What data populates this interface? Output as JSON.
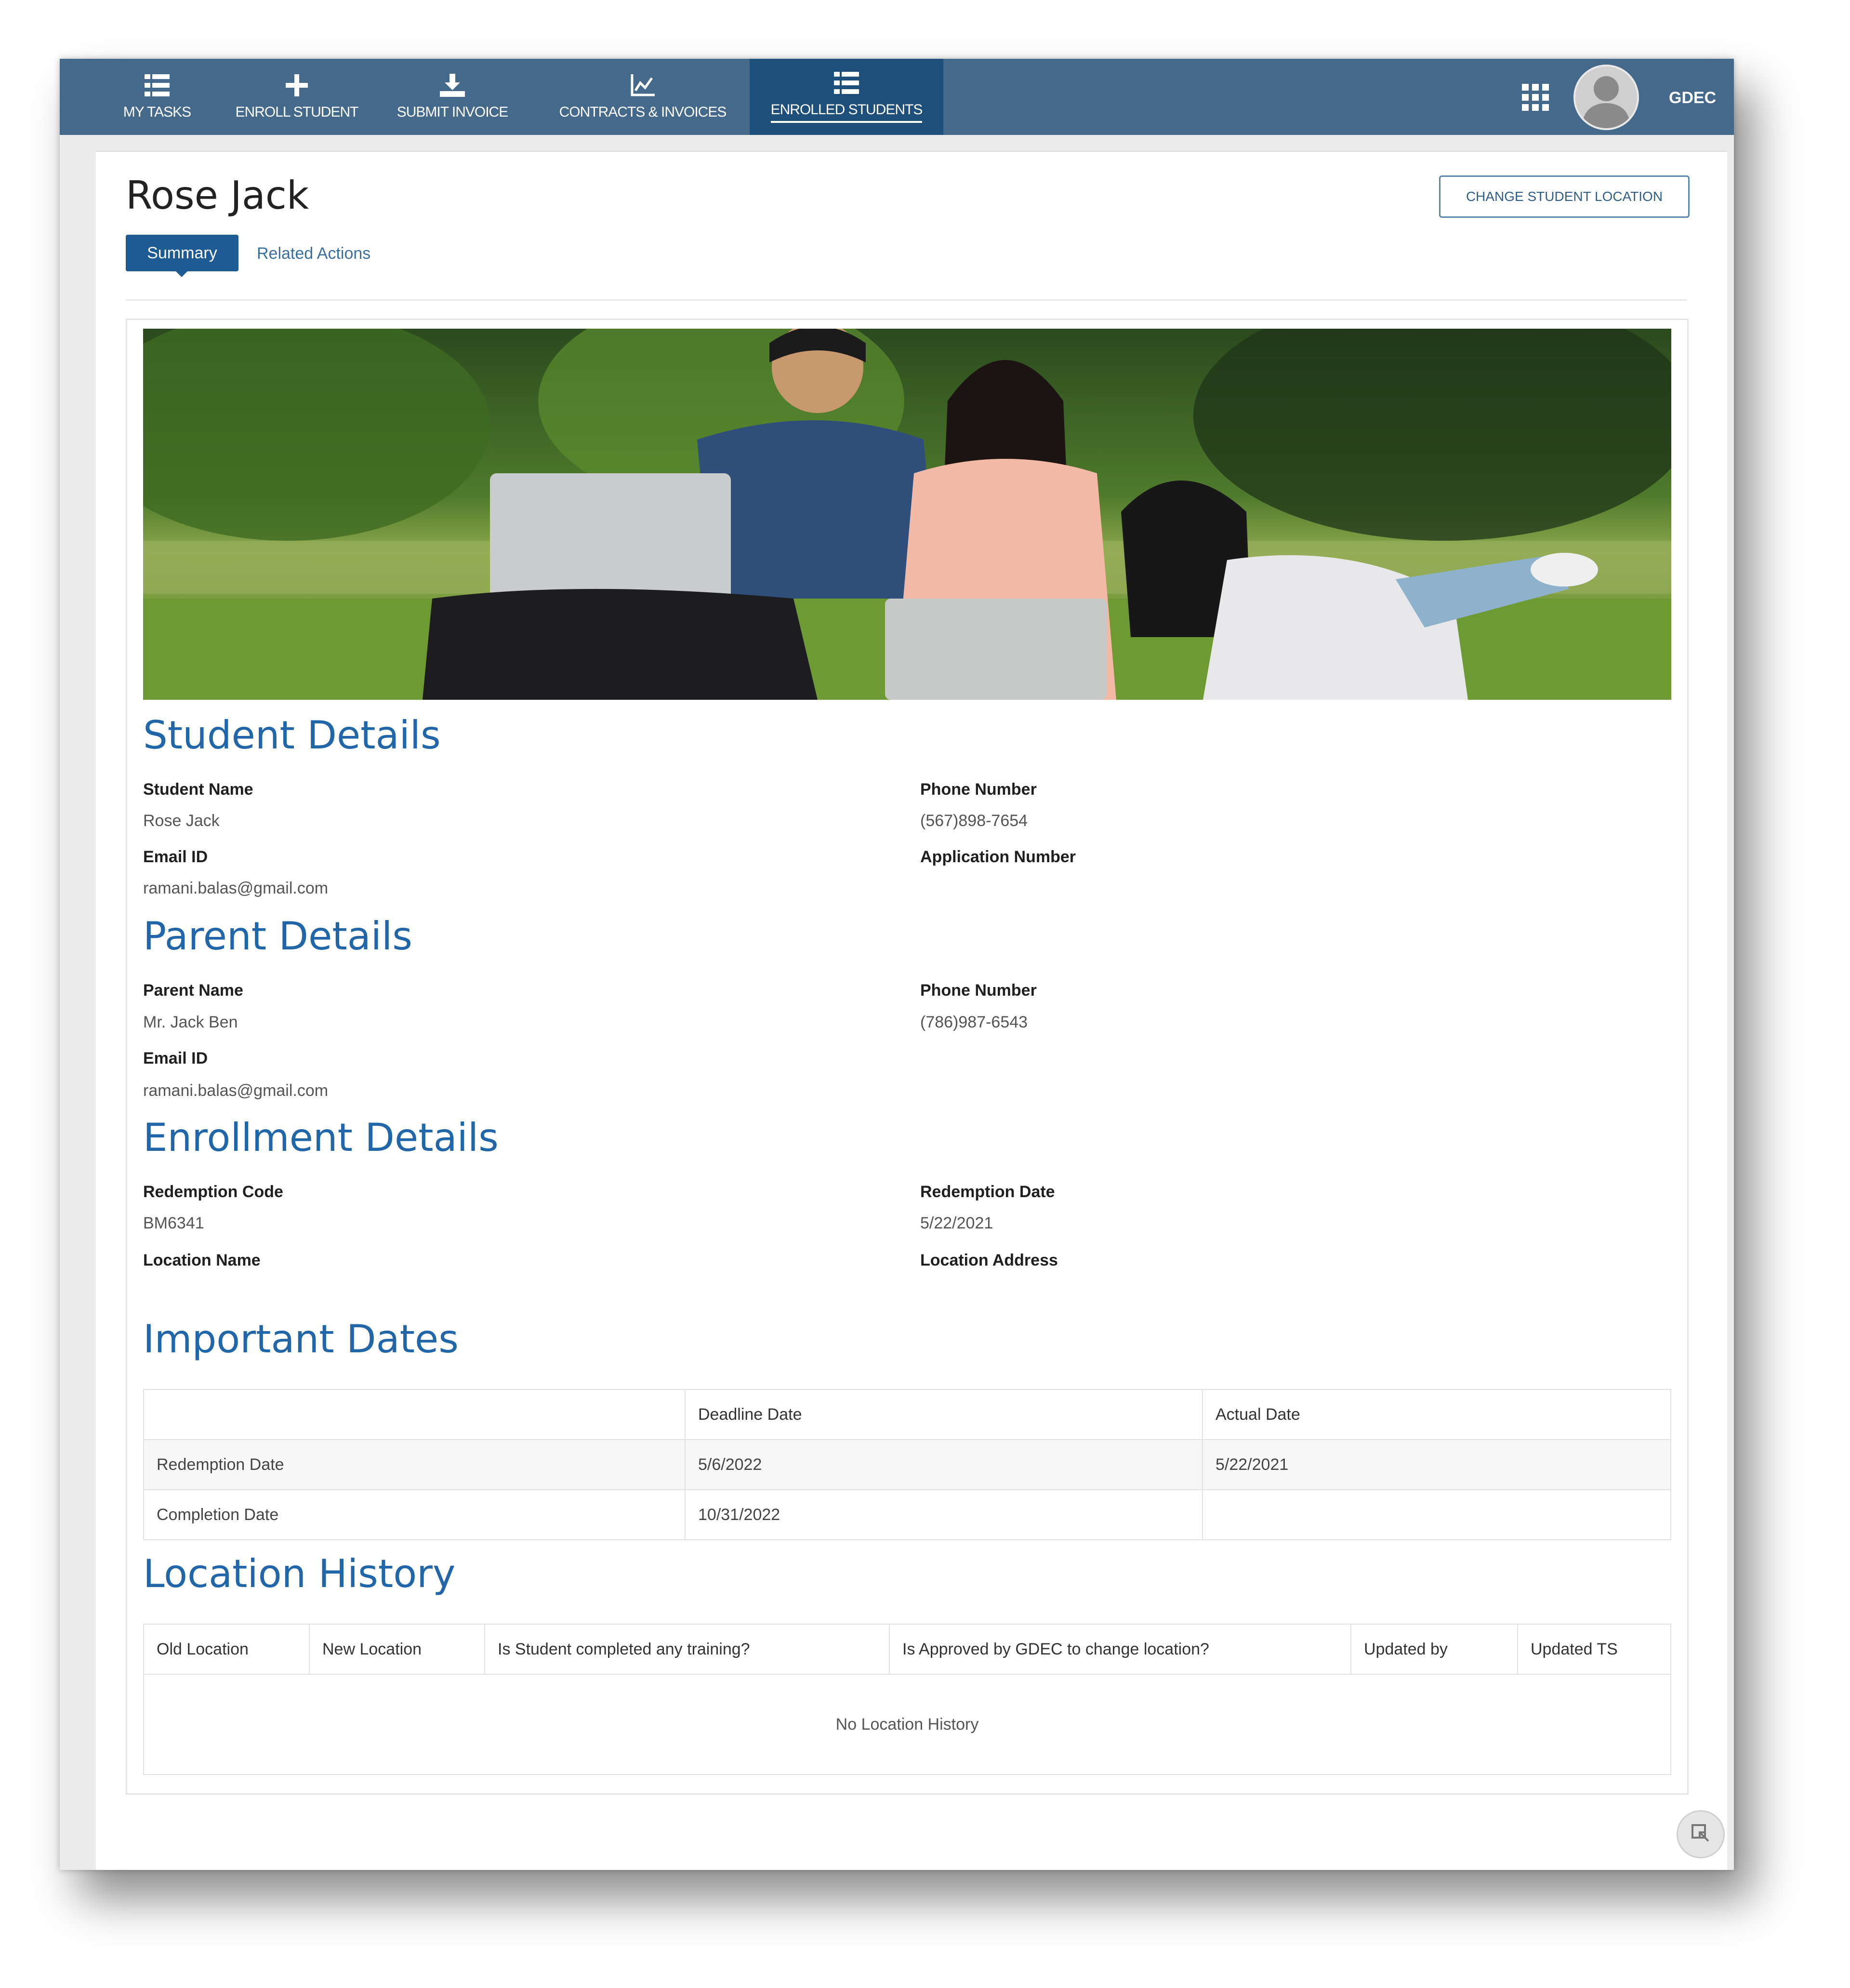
{
  "nav": {
    "items": [
      {
        "label": "MY TASKS",
        "icon": "list-icon"
      },
      {
        "label": "ENROLL STUDENT",
        "icon": "plus-icon"
      },
      {
        "label": "SUBMIT INVOICE",
        "icon": "upload-icon"
      },
      {
        "label": "CONTRACTS & INVOICES",
        "icon": "chart-icon"
      },
      {
        "label": "ENROLLED STUDENTS",
        "icon": "list-icon",
        "active": true
      }
    ],
    "user": "GDEC",
    "apps_icon": "grid-icon",
    "avatar_icon": "avatar-icon"
  },
  "page": {
    "title": "Rose Jack",
    "change_location_button": "CHANGE STUDENT LOCATION",
    "tabs": [
      "Summary",
      "Related Actions"
    ]
  },
  "student_details": {
    "title": "Student Details",
    "student_name_label": "Student Name",
    "student_name": "Rose Jack",
    "phone_label": "Phone Number",
    "phone": "(567)898-7654",
    "email_label": "Email ID",
    "email": "ramani.balas@gmail.com",
    "application_label": "Application Number",
    "application": ""
  },
  "parent_details": {
    "title": "Parent Details",
    "parent_name_label": "Parent Name",
    "parent_name": "Mr. Jack Ben",
    "phone_label": "Phone Number",
    "phone": "(786)987-6543",
    "email_label": "Email ID",
    "email": "ramani.balas@gmail.com"
  },
  "enrollment_details": {
    "title": "Enrollment Details",
    "redemption_code_label": "Redemption Code",
    "redemption_code": "BM6341",
    "redemption_date_label": "Redemption Date",
    "redemption_date": "5/22/2021",
    "location_name_label": "Location Name",
    "location_name": "",
    "location_address_label": "Location Address",
    "location_address": ""
  },
  "important_dates": {
    "title": "Important Dates",
    "headers": [
      "",
      "Deadline Date",
      "Actual Date"
    ],
    "rows": [
      [
        "Redemption Date",
        "5/6/2022",
        "5/22/2021"
      ],
      [
        "Completion Date",
        "10/31/2022",
        ""
      ]
    ]
  },
  "location_history": {
    "title": "Location History",
    "headers": [
      "Old Location",
      "New Location",
      "Is Student completed any training?",
      "Is Approved by GDEC to change location?",
      "Updated by",
      "Updated TS"
    ],
    "empty_message": "No Location History"
  },
  "colors": {
    "nav_bg": "#44698b",
    "nav_active": "#1e4f7a",
    "section_title": "#2166a8",
    "tab_active": "#1e5a94"
  }
}
